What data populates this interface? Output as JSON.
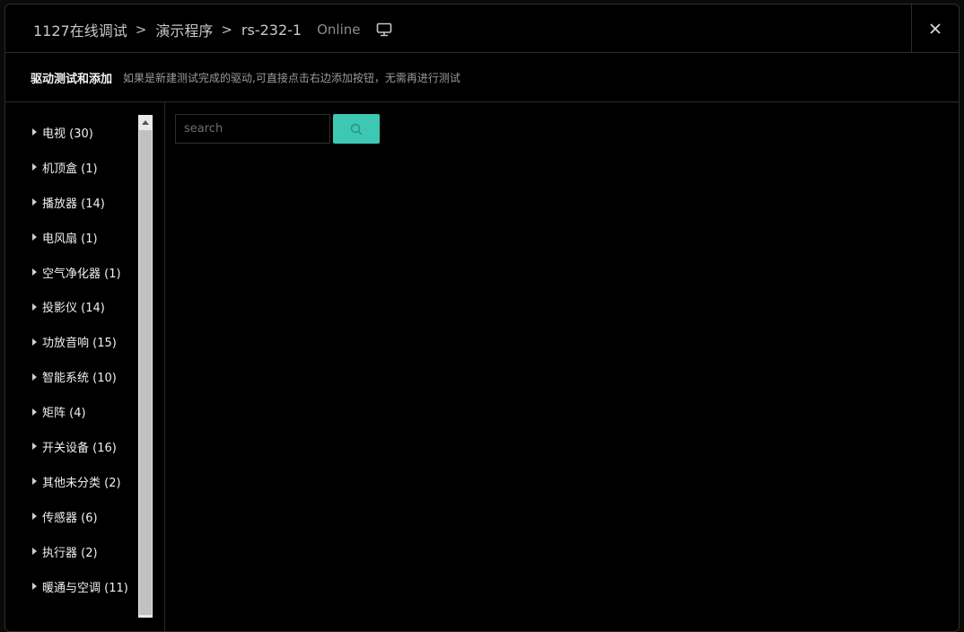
{
  "header": {
    "breadcrumbs": [
      "1127在线调试",
      "演示程序",
      "rs-232-1"
    ],
    "separator": ">",
    "status": "Online",
    "close_label": "✕"
  },
  "subheader": {
    "title": "驱动测试和添加",
    "description": "如果是新建测试完成的驱动,可直接点击右边添加按钮，无需再进行测试"
  },
  "tree": {
    "items": [
      {
        "label": "电视 (30)"
      },
      {
        "label": "机顶盒 (1)"
      },
      {
        "label": "播放器 (14)"
      },
      {
        "label": "电风扇 (1)"
      },
      {
        "label": "空气净化器 (1)"
      },
      {
        "label": "投影仪 (14)"
      },
      {
        "label": "功放音响 (15)"
      },
      {
        "label": "智能系统 (10)"
      },
      {
        "label": "矩阵 (4)"
      },
      {
        "label": "开关设备 (16)"
      },
      {
        "label": "其他未分类 (2)"
      },
      {
        "label": "传感器 (6)"
      },
      {
        "label": "执行器 (2)"
      },
      {
        "label": "暖通与空调 (11)"
      }
    ]
  },
  "search": {
    "placeholder": "search",
    "value": "",
    "icon": "search-icon"
  },
  "colors": {
    "accent": "#3cc8b4",
    "background": "#000000",
    "border": "#2b2b2b"
  }
}
